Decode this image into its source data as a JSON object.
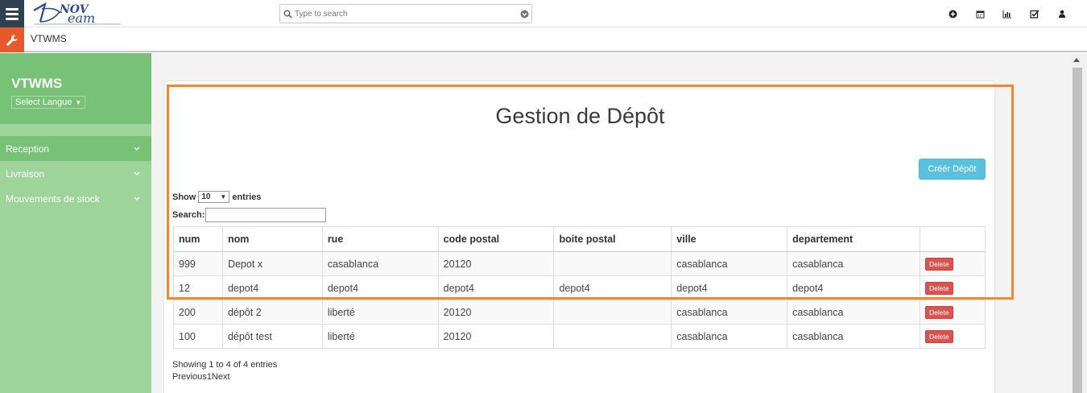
{
  "topbar": {
    "search_placeholder": "Type to search",
    "icons": [
      "plus-circle-icon",
      "calendar-icon",
      "bar-chart-icon",
      "checkbox-icon",
      "user-icon"
    ]
  },
  "subbar": {
    "crumb": "VTWMS"
  },
  "sidebar": {
    "title": "VTWMS",
    "lang_label": "Select Langue",
    "items": [
      {
        "label": "Reception"
      },
      {
        "label": "Livraison"
      },
      {
        "label": "Mouvements de stock"
      }
    ]
  },
  "main": {
    "title": "Gestion de Dépôt",
    "create_label": "Créér Dépôt",
    "show_label": "Show",
    "entries_value": "10",
    "entries_label": "entries",
    "search_label": "Search:",
    "columns": [
      "num",
      "nom",
      "rue",
      "code postal",
      "boite postal",
      "ville",
      "departement",
      ""
    ],
    "rows": [
      [
        "999",
        "Depot x",
        "casablanca",
        "20120",
        "",
        "casablanca",
        "casablanca"
      ],
      [
        "12",
        "depot4",
        "depot4",
        "depot4",
        "depot4",
        "depot4",
        "depot4"
      ],
      [
        "200",
        "dépôt 2",
        "liberté",
        "20120",
        "",
        "casablanca",
        "casablanca"
      ],
      [
        "100",
        "dépôt test",
        "liberté",
        "20120",
        "",
        "casablanca",
        "casablanca"
      ]
    ],
    "delete_label": "Delete",
    "info": "Showing 1 to 4 of 4 entries",
    "pager": "Previous1Next"
  },
  "colors": {
    "sidebar": "#9ed49a",
    "sidebar_head": "#78c277",
    "accent": "#e8592a",
    "highlight": "#f5862b",
    "create_btn": "#5bc0de",
    "delete_btn": "#d9534f"
  }
}
